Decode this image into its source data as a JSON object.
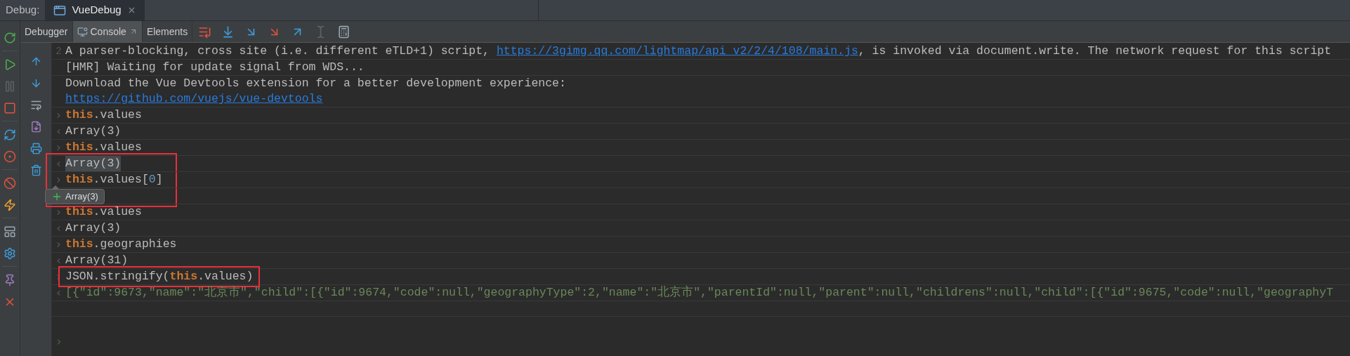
{
  "header": {
    "label": "Debug:",
    "tab": {
      "title": "VueDebug",
      "selected": true
    }
  },
  "rail": [
    {
      "kind": "rerun",
      "disabled": false
    },
    {
      "kind": "resume",
      "disabled": false
    },
    {
      "kind": "pause",
      "disabled": true
    },
    {
      "kind": "stop",
      "disabled": false
    },
    {
      "kind": "restart",
      "disabled": false
    },
    {
      "kind": "breakpoints",
      "disabled": false
    },
    {
      "kind": "mute",
      "disabled": false
    },
    {
      "kind": "lightning",
      "disabled": false
    },
    {
      "kind": "layout",
      "disabled": false
    },
    {
      "kind": "settings",
      "disabled": false
    },
    {
      "kind": "pin",
      "disabled": false
    },
    {
      "kind": "close",
      "disabled": false
    }
  ],
  "toolbar": {
    "tabs": [
      {
        "label": "Debugger",
        "selected": false
      },
      {
        "label": "Console",
        "selected": true
      },
      {
        "label": "Elements",
        "selected": false
      }
    ],
    "actions": [
      {
        "kind": "execution-point",
        "disabled": false
      },
      {
        "kind": "step-over",
        "disabled": false
      },
      {
        "kind": "step-into",
        "disabled": false
      },
      {
        "kind": "force-step-into",
        "disabled": false
      },
      {
        "kind": "step-out",
        "disabled": false
      },
      {
        "kind": "run-to-cursor",
        "disabled": true
      },
      {
        "kind": "evaluate",
        "disabled": false
      }
    ]
  },
  "console_tools": [
    {
      "kind": "up"
    },
    {
      "kind": "down"
    },
    {
      "kind": "wrap"
    },
    {
      "kind": "export"
    },
    {
      "kind": "print"
    },
    {
      "kind": "clear"
    }
  ],
  "console": {
    "messages": [
      {
        "kind": "log",
        "count": "2",
        "highlighted": false,
        "outlined": false,
        "lines": [
          [
            {
              "kind": "text",
              "text": "A parser-blocking, cross site (i.e. different eTLD+1) script, "
            },
            {
              "kind": "link",
              "text": "https://3gimg.qq.com/lightmap/api_v2/2/4/108/main.js"
            },
            {
              "kind": "text",
              "text": ", is invoked via document.write. The network request for this script"
            }
          ]
        ]
      },
      {
        "kind": "log",
        "highlighted": false,
        "outlined": false,
        "lines": [
          [
            {
              "kind": "text",
              "text": "[HMR] Waiting for update signal from WDS..."
            }
          ]
        ]
      },
      {
        "kind": "log",
        "highlighted": false,
        "outlined": false,
        "lines": [
          [
            {
              "kind": "text",
              "text": "Download the Vue Devtools extension for a better development experience:"
            }
          ],
          [
            {
              "kind": "link",
              "text": "https://github.com/vuejs/vue-devtools"
            }
          ]
        ]
      },
      {
        "kind": "input",
        "highlighted": false,
        "outlined": false,
        "lines": [
          [
            {
              "kind": "keyword",
              "text": "this"
            },
            {
              "kind": "text",
              "text": ".values"
            }
          ]
        ]
      },
      {
        "kind": "output",
        "highlighted": false,
        "outlined": false,
        "lines": [
          [
            {
              "kind": "text",
              "text": "Array(3)"
            }
          ]
        ]
      },
      {
        "kind": "input",
        "highlighted": false,
        "outlined": false,
        "lines": [
          [
            {
              "kind": "keyword",
              "text": "this"
            },
            {
              "kind": "text",
              "text": ".values"
            }
          ]
        ]
      },
      {
        "kind": "output",
        "highlighted": true,
        "outlined": true,
        "tooltip": "Array(3)",
        "lines": [
          [
            {
              "kind": "text",
              "text": "Array(3)"
            }
          ]
        ]
      },
      {
        "kind": "input",
        "highlighted": false,
        "outlined": true,
        "lines": [
          [
            {
              "kind": "keyword",
              "text": "this"
            },
            {
              "kind": "text",
              "text": ".values["
            },
            {
              "kind": "number",
              "text": "0"
            },
            {
              "kind": "text",
              "text": "]"
            }
          ]
        ]
      },
      {
        "kind": "covered",
        "highlighted": false,
        "outlined": true
      },
      {
        "kind": "input",
        "highlighted": false,
        "outlined": false,
        "lines": [
          [
            {
              "kind": "keyword",
              "text": "this"
            },
            {
              "kind": "text",
              "text": ".values"
            }
          ]
        ]
      },
      {
        "kind": "output",
        "highlighted": false,
        "outlined": false,
        "lines": [
          [
            {
              "kind": "text",
              "text": "Array(3)"
            }
          ]
        ]
      },
      {
        "kind": "input",
        "highlighted": false,
        "outlined": false,
        "lines": [
          [
            {
              "kind": "keyword",
              "text": "this"
            },
            {
              "kind": "text",
              "text": ".geographies"
            }
          ]
        ]
      },
      {
        "kind": "output",
        "highlighted": false,
        "outlined": false,
        "lines": [
          [
            {
              "kind": "text",
              "text": "Array(31)"
            }
          ]
        ]
      },
      {
        "kind": "input",
        "highlighted": false,
        "outlined": true,
        "lines": [
          [
            {
              "kind": "text",
              "text": "JSON.stringify("
            },
            {
              "kind": "keyword",
              "text": "this"
            },
            {
              "kind": "text",
              "text": ".values)"
            }
          ]
        ]
      },
      {
        "kind": "output",
        "highlighted": false,
        "outlined": false,
        "lines": [
          [
            {
              "kind": "json",
              "text": "[{\"id\":9673,\"name\":\"北京市\",\"child\":[{\"id\":9674,\"code\":null,\"geographyType\":2,\"name\":\"北京市\",\"parentId\":null,\"parent\":null,\"childrens\":null,\"child\":[{\"id\":9675,\"code\":null,\"geographyT"
            }
          ]
        ]
      }
    ]
  }
}
